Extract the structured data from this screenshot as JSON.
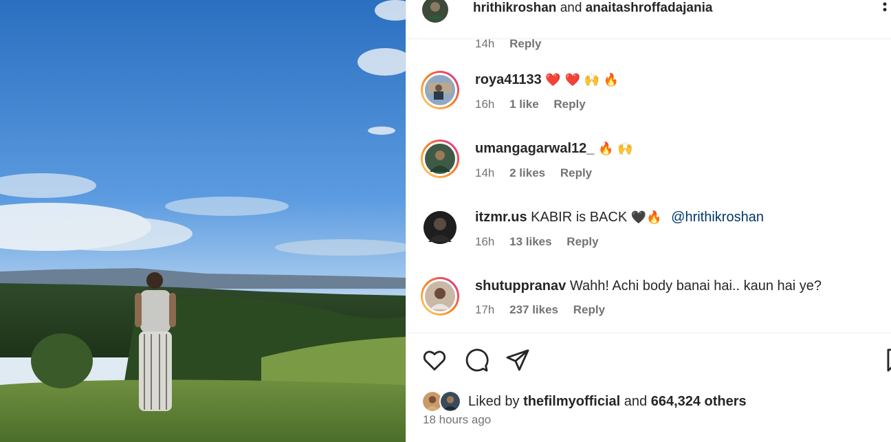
{
  "header": {
    "user1": "hrithikroshan",
    "joiner": "and",
    "user2": "anaitashroffadajania",
    "top_comment_time": "14h",
    "top_comment_reply": "Reply"
  },
  "comments": [
    {
      "username": "roya41133",
      "text": "",
      "emojis": "❤️ ❤️ 🙌 🔥",
      "time": "16h",
      "likes": "1 like",
      "reply": "Reply",
      "ring_color": "#d6249f"
    },
    {
      "username": "umangagarwal12_",
      "text": "",
      "emojis": "🔥 🙌",
      "time": "14h",
      "likes": "2 likes",
      "reply": "Reply",
      "ring_color": "#d6249f"
    },
    {
      "username": "itzmr.us",
      "text": "KABIR is BACK",
      "emojis": "🖤🔥",
      "mention": "@hrithikroshan",
      "time": "16h",
      "likes": "13 likes",
      "reply": "Reply",
      "ring_color": ""
    },
    {
      "username": "shutuppranav",
      "text": "Wahh! Achi body banai hai.. kaun hai ye?",
      "emojis": "",
      "time": "17h",
      "likes": "237 likes",
      "reply": "Reply",
      "ring_color": "#d6249f"
    }
  ],
  "actions": {
    "icons": [
      "heart-icon",
      "comment-icon",
      "share-icon",
      "bookmark-icon"
    ]
  },
  "likes": {
    "prefix": "Liked by",
    "user": "thefilmyofficial",
    "joiner": "and",
    "count": "664,324 others"
  },
  "timestamp": "18 hours ago",
  "colors": {
    "text": "#262626",
    "secondary": "#737373",
    "mention": "#00376b",
    "story_ring_start": "#feda75",
    "story_ring_end": "#d6249f"
  }
}
